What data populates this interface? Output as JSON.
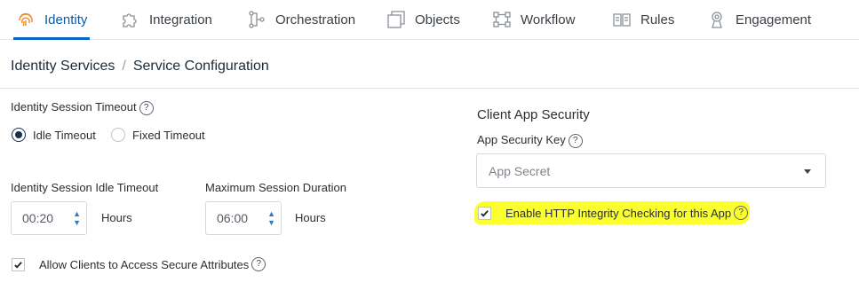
{
  "tabs": [
    {
      "label": "Identity",
      "icon": "fingerprint-icon",
      "active": true
    },
    {
      "label": "Integration",
      "icon": "puzzle-icon"
    },
    {
      "label": "Orchestration",
      "icon": "orchestration-icon"
    },
    {
      "label": "Objects",
      "icon": "objects-icon"
    },
    {
      "label": "Workflow",
      "icon": "workflow-icon"
    },
    {
      "label": "Rules",
      "icon": "rules-icon"
    },
    {
      "label": "Engagement",
      "icon": "engagement-icon"
    }
  ],
  "breadcrumb": {
    "root": "Identity Services",
    "separator": "/",
    "current": "Service Configuration"
  },
  "session": {
    "timeout_label": "Identity Session Timeout",
    "options": [
      "Idle Timeout",
      "Fixed Timeout"
    ],
    "selected": "Idle Timeout",
    "idle_timeout_label": "Identity Session Idle Timeout",
    "idle_timeout_value": "00:20",
    "idle_timeout_unit": "Hours",
    "max_duration_label": "Maximum Session Duration",
    "max_duration_value": "06:00",
    "max_duration_unit": "Hours",
    "allow_secure_label": "Allow Clients to Access Secure Attributes",
    "allow_secure_checked": true
  },
  "client_security": {
    "heading": "Client App Security",
    "key_label": "App Security Key",
    "key_placeholder": "App Secret",
    "integrity_label": "Enable HTTP Integrity Checking for this App",
    "integrity_checked": true
  },
  "help_glyph": "?",
  "colors": {
    "accent": "#0a64c2",
    "highlight": "#fcff2e",
    "radio_fill": "#16324f"
  }
}
